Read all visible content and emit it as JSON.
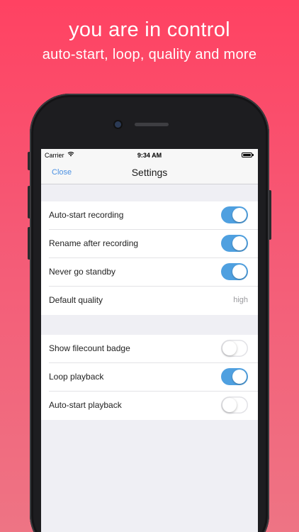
{
  "promo": {
    "headline": "you are in control",
    "subhead": "auto-start, loop, quality and more",
    "background_top": "#ff4262",
    "background_bottom": "#ee7484"
  },
  "status_bar": {
    "carrier": "Carrier",
    "time": "9:34 AM"
  },
  "nav": {
    "close_label": "Close",
    "title": "Settings"
  },
  "settings": {
    "group1": [
      {
        "label": "Auto-start recording",
        "type": "toggle",
        "on": true
      },
      {
        "label": "Rename after recording",
        "type": "toggle",
        "on": true
      },
      {
        "label": "Never go standby",
        "type": "toggle",
        "on": true
      },
      {
        "label": "Default quality",
        "type": "value",
        "value": "high"
      }
    ],
    "group2": [
      {
        "label": "Show filecount badge",
        "type": "toggle",
        "on": false
      },
      {
        "label": "Loop playback",
        "type": "toggle",
        "on": true
      },
      {
        "label": "Auto-start playback",
        "type": "toggle",
        "on": false
      }
    ]
  },
  "colors": {
    "accent": "#4a90e2",
    "toggle_on": "#4fa0e0"
  }
}
